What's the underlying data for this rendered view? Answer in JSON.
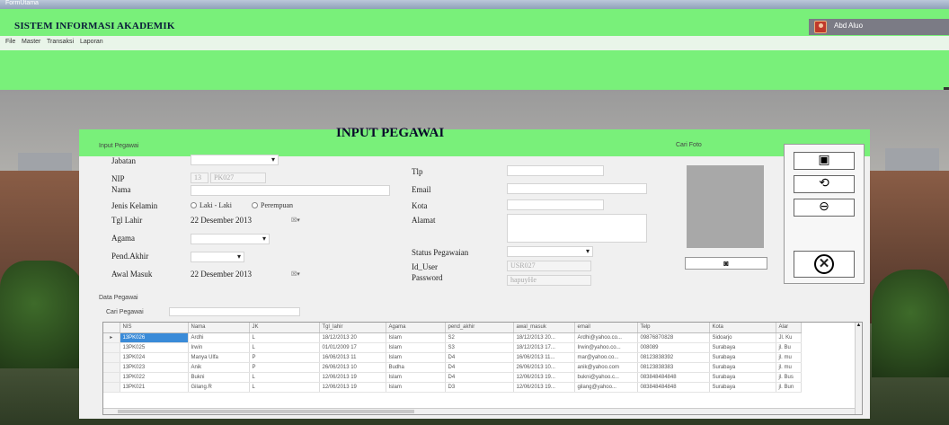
{
  "window": {
    "title": "FormUtama"
  },
  "header": {
    "app_title": "SISTEM INFORMASI AKADEMIK",
    "user_name": "Abd Aluo"
  },
  "menu": [
    "File",
    "Master",
    "Transaksi",
    "Laporan"
  ],
  "form": {
    "title": "INPUT PEGAWAI",
    "group_input": "Input Pegawai",
    "group_photo": "Cari Foto",
    "group_data": "Data Pegawai",
    "labels": {
      "jabatan": "Jabatan",
      "nip": "NIP",
      "nama": "Nama",
      "jenis_kelamin": "Jenis Kelamin",
      "tgl_lahir": "Tgl Lahir",
      "agama": "Agama",
      "pend_akhir": "Pend.Akhir",
      "awal_masuk": "Awal Masuk",
      "telp": "Tlp",
      "email": "Email",
      "kota": "Kota",
      "alamat": "Alamat",
      "status_pegawai": "Status Pegawaian",
      "id_user": "Id_User",
      "password": "Password"
    },
    "values": {
      "nip_prefix": "13",
      "nip": "PK027",
      "tgl_lahir": "22 Desember 2013",
      "awal_masuk": "22 Desember 2013",
      "id_user": "USR027",
      "password": "hapuyHe",
      "date_button": "☒▾"
    },
    "radio": {
      "male": "Laki - Laki",
      "female": "Perempuan"
    },
    "search_label": "Cari Pegawai",
    "icons": {
      "save": "save-icon",
      "refresh": "refresh-icon",
      "delete": "minus-circle-icon",
      "close": "close-icon",
      "camera": "camera-icon"
    },
    "close_glyph": "✕"
  },
  "grid": {
    "columns": [
      "NIS",
      "Nama",
      "JK",
      "Tgl_lahir",
      "Agama",
      "pend_akhir",
      "awal_masuk",
      "email",
      "Telp",
      "Kota",
      "Alar"
    ],
    "rows": [
      [
        "13PK026",
        "Ardhi",
        "L",
        "18/12/2013 20",
        "Islam",
        "S2",
        "18/12/2013 20...",
        "Ardhi@yahoo.co...",
        "09876870828",
        "Sidoarjo",
        "Jl. Ku"
      ],
      [
        "13PK025",
        "Irwin",
        "L",
        "01/01/2009 17",
        "Islam",
        "S3",
        "18/12/2013 17...",
        "Irwin@yahoo.co...",
        "008089",
        "Surabaya",
        "jl. Bu"
      ],
      [
        "13PK024",
        "Manya Ulfa",
        "P",
        "16/06/2013 11",
        "Islam",
        "D4",
        "16/06/2013 11...",
        "mar@yahoo.co...",
        "08123838392",
        "Surabaya",
        "jl. mu"
      ],
      [
        "13PK023",
        "Anik",
        "P",
        "26/06/2013 10",
        "Budha",
        "D4",
        "26/06/2013 10...",
        "anik@yahoo.com",
        "08123838383",
        "Surabaya",
        "jl. mu"
      ],
      [
        "13PK022",
        "Bukni",
        "L",
        "12/06/2013 19",
        "Islam",
        "D4",
        "12/06/2013 19...",
        "bukni@yahoo.c...",
        "083848484848",
        "Surabaya",
        "jl. Bus"
      ],
      [
        "13PK021",
        "Gilang.R",
        "L",
        "12/06/2013 19",
        "Islam",
        "D3",
        "12/06/2013 19...",
        "gilang@yahoo...",
        "083848484848",
        "Surabaya",
        "jl. Bun"
      ]
    ]
  }
}
